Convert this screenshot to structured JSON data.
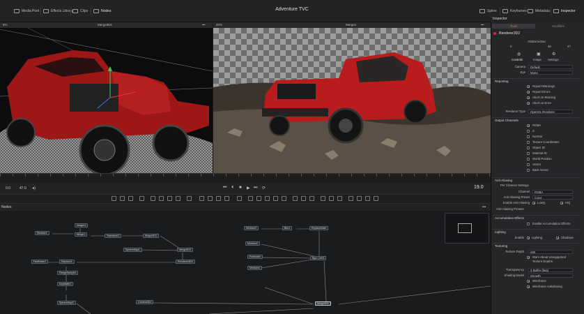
{
  "app": {
    "title": "Adventure TVC",
    "nav_left": [
      "Media Pool",
      "Effects Library",
      "Clips",
      "Nodes"
    ],
    "nav_right": [
      "Spline",
      "Keyframes",
      "Metadata",
      "Inspector"
    ]
  },
  "viewer_left": {
    "zoom": "8%",
    "name": "Merge3D1"
  },
  "viewer_right": {
    "zoom": "40%",
    "name": "Merge2"
  },
  "timeline": {
    "start": "0.0",
    "end": "47.0",
    "current": "19.0"
  },
  "nodes_panel": {
    "title": "Nodes",
    "nodes": [
      "Imager1",
      "Merge1",
      "Mediain1",
      "Transform1",
      "Shape3D1",
      "Merge3D3",
      "SphereMap1",
      "Renderer3D4",
      "Displace1",
      "FastNoise1",
      "Mediain2",
      "Blur1",
      "ReplaceMate",
      "RangeSampler",
      "KeyMatte1",
      "Fastnoise",
      "SphereMap3",
      "Mediain3",
      "Mediain4",
      "Bgm_reel1",
      "Merge3D1",
      "Camera3D1"
    ]
  },
  "inspector": {
    "title": "Inspector",
    "tabs": [
      "Tools",
      "Modifiers"
    ],
    "node_name": "Renderer3D2",
    "global_in_out_label": "Global In/Out",
    "global_in_out": [
      "0",
      "48",
      "47"
    ],
    "sub_tabs": [
      "Controls",
      "Image",
      "Settings"
    ],
    "camera_label": "Camera",
    "camera_value": "Default",
    "eye_label": "Eye",
    "eye_value": "Mono",
    "reporting_label": "Reporting",
    "reporting_items": [
      "Report Warnings",
      "Report Errors",
      "Abort on Warning",
      "Abort on Error"
    ],
    "renderer_type_label": "Renderer Type",
    "renderer_type_value": "OpenGL Renderer",
    "output_channels_label": "Output Channels",
    "output_channels": [
      "RGBA",
      "Z",
      "Normal",
      "Texture Coordinates",
      "Object ID",
      "Material ID",
      "World Position",
      "Vector",
      "Back Vector"
    ],
    "anti_aliasing_label": "Anti-Aliasing",
    "per_channel_label": "Per Channel Settings",
    "channel_label": "Channel",
    "channel_value": "RGBA",
    "aa_preset_label": "Anti-Aliasing Preset",
    "aa_preset_value": "Color",
    "enable_aa_label": "Enable Anti-Aliasing",
    "enable_aa_lowq": "LowQ",
    "enable_aa_hiq": "HiQ",
    "aa_presets_label": "Anti-Aliasing Presets",
    "accumulation_label": "Accumulation Effects",
    "enable_accumulation_label": "Enable Accumulation Effects",
    "lighting_label": "Lighting",
    "enable_label": "Enable",
    "lighting_value": "Lighting",
    "shadows_value": "Shadows",
    "texturing_label": "Texturing",
    "texture_depth_label": "Texture Depth",
    "texture_depth_value": "int8",
    "warn_unsupported": "Warn About Unsupported",
    "texture_depths": "Texture Depths",
    "transparency_label": "Transparency",
    "transparency_value": "Z Buffer (fast)",
    "shading_model_label": "Shading Model",
    "shading_model_value": "Smooth",
    "wireframe_label": "Wireframe",
    "wireframe_aa_label": "Wireframe Antialiasing"
  }
}
